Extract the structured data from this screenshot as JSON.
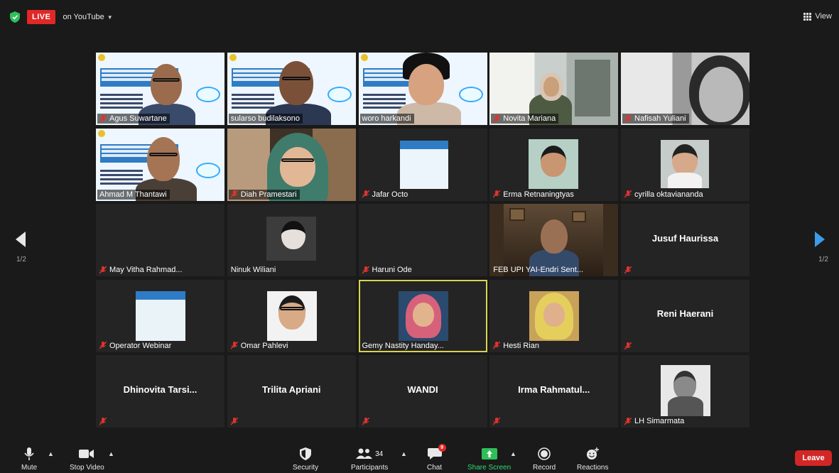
{
  "topbar": {
    "live_label": "LIVE",
    "destination": "on YouTube",
    "view_label": "View"
  },
  "pagination": {
    "left": "1/2",
    "right": "1/2"
  },
  "participants": [
    {
      "name": "Agus Suwartane",
      "muted": true
    },
    {
      "name": "sularso budilaksono",
      "muted": false
    },
    {
      "name": "woro harkandi",
      "muted": false
    },
    {
      "name": "Novita Mariana",
      "muted": true
    },
    {
      "name": "Nafisah Yuliani",
      "muted": true
    },
    {
      "name": "Ahmad M Thantawi",
      "muted": false
    },
    {
      "name": "Diah Pramestari",
      "muted": true
    },
    {
      "name": "Jafar Octo",
      "muted": true
    },
    {
      "name": "Erma Retnaningtyas",
      "muted": true
    },
    {
      "name": "cyrilla oktaviananda",
      "muted": true
    },
    {
      "name": "May Vitha Rahmad...",
      "muted": true
    },
    {
      "name": "Ninuk Wiliani",
      "muted": false
    },
    {
      "name": "Haruni Ode",
      "muted": true
    },
    {
      "name": "FEB UPI YAI-Endri Sent...",
      "muted": false
    },
    {
      "name": "Jusuf Haurissa",
      "muted": true,
      "no_video": true
    },
    {
      "name": "Operator Webinar",
      "muted": true
    },
    {
      "name": "Omar Pahlevi",
      "muted": true
    },
    {
      "name": "Gemy Nastity Handay...",
      "muted": false
    },
    {
      "name": "Hesti Rian",
      "muted": true
    },
    {
      "name": "Reni Haerani",
      "muted": true,
      "no_video": true
    },
    {
      "name": "Dhinovita Tarsi...",
      "muted": true,
      "no_video": true
    },
    {
      "name": "Trilita Apriani",
      "muted": true,
      "no_video": true
    },
    {
      "name": "WANDI",
      "muted": true,
      "no_video": true
    },
    {
      "name": "Irma Rahmatul...",
      "muted": true,
      "no_video": true
    },
    {
      "name": "LH Simarmata",
      "muted": true
    }
  ],
  "toolbar": {
    "mute": "Mute",
    "stop_video": "Stop Video",
    "security": "Security",
    "participants": "Participants",
    "participant_count": "34",
    "chat": "Chat",
    "chat_badge": "9",
    "share_screen": "Share Screen",
    "record": "Record",
    "reactions": "Reactions",
    "leave": "Leave"
  },
  "colors": {
    "background": "#1a1a1a",
    "tile": "#242424",
    "live": "#e02828",
    "speaker_outline": "#d9d253",
    "share_green": "#2fdc6a",
    "leave": "#d32626",
    "nav_blue": "#3d9be9"
  }
}
